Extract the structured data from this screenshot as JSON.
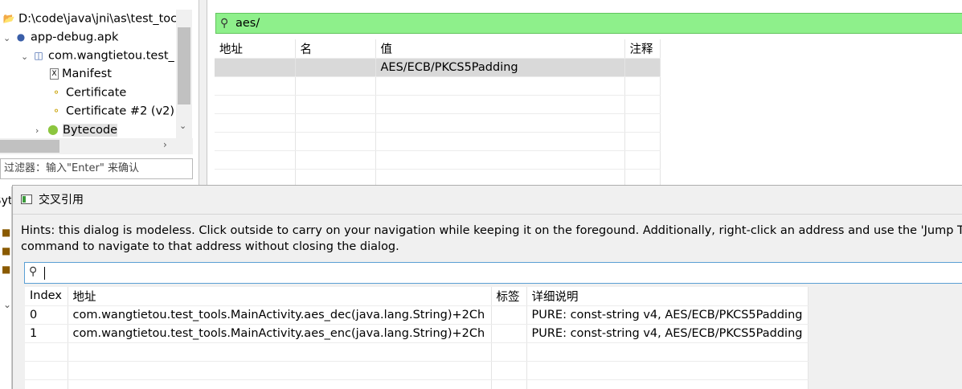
{
  "tree": {
    "root_path": "D:\\code\\java\\jni\\as\\test_toc",
    "apk": "app-debug.apk",
    "package": "com.wangtietou.test_",
    "items": [
      {
        "label": "Manifest",
        "icon": "manifest-icon"
      },
      {
        "label": "Certificate",
        "icon": "key-icon"
      },
      {
        "label": "Certificate #2 (v2)",
        "icon": "key-icon"
      },
      {
        "label": "Bytecode",
        "icon": "android-icon"
      }
    ],
    "filter_placeholder": "过滤器：输入\"Enter\" 来确认"
  },
  "search": {
    "query": "aes/",
    "columns": [
      "地址",
      "名",
      "值",
      "注释"
    ],
    "rows": [
      {
        "address": "",
        "name": "",
        "value": "AES/ECB/PKCS5Padding",
        "comment": ""
      }
    ]
  },
  "dialog": {
    "title": "交叉引用",
    "hints_line1": "Hints: this dialog is modeless. Click outside to carry on your navigation while keeping it on the foregound. Additionally, right-click an address and use the 'Jump T",
    "hints_line2": "command to navigate to that address without closing the dialog.",
    "search_value": "",
    "columns": [
      "Index",
      "地址",
      "标签",
      "详细说明"
    ],
    "rows": [
      {
        "index": "0",
        "address": "com.wangtietou.test_tools.MainActivity.aes_dec(java.lang.String)+2Ch",
        "label": "",
        "detail": "PURE: const-string v4, AES/ECB/PKCS5Padding"
      },
      {
        "index": "1",
        "address": "com.wangtietou.test_tools.MainActivity.aes_enc(java.lang.String)+2Ch",
        "label": "",
        "detail": "PURE: const-string v4, AES/ECB/PKCS5Padding"
      }
    ]
  },
  "background": {
    "tab_fragment": "Byt"
  },
  "colors": {
    "search_highlight": "#8ef08b",
    "selection": "#d9d9d9",
    "focus_border": "#5a9fd4"
  }
}
